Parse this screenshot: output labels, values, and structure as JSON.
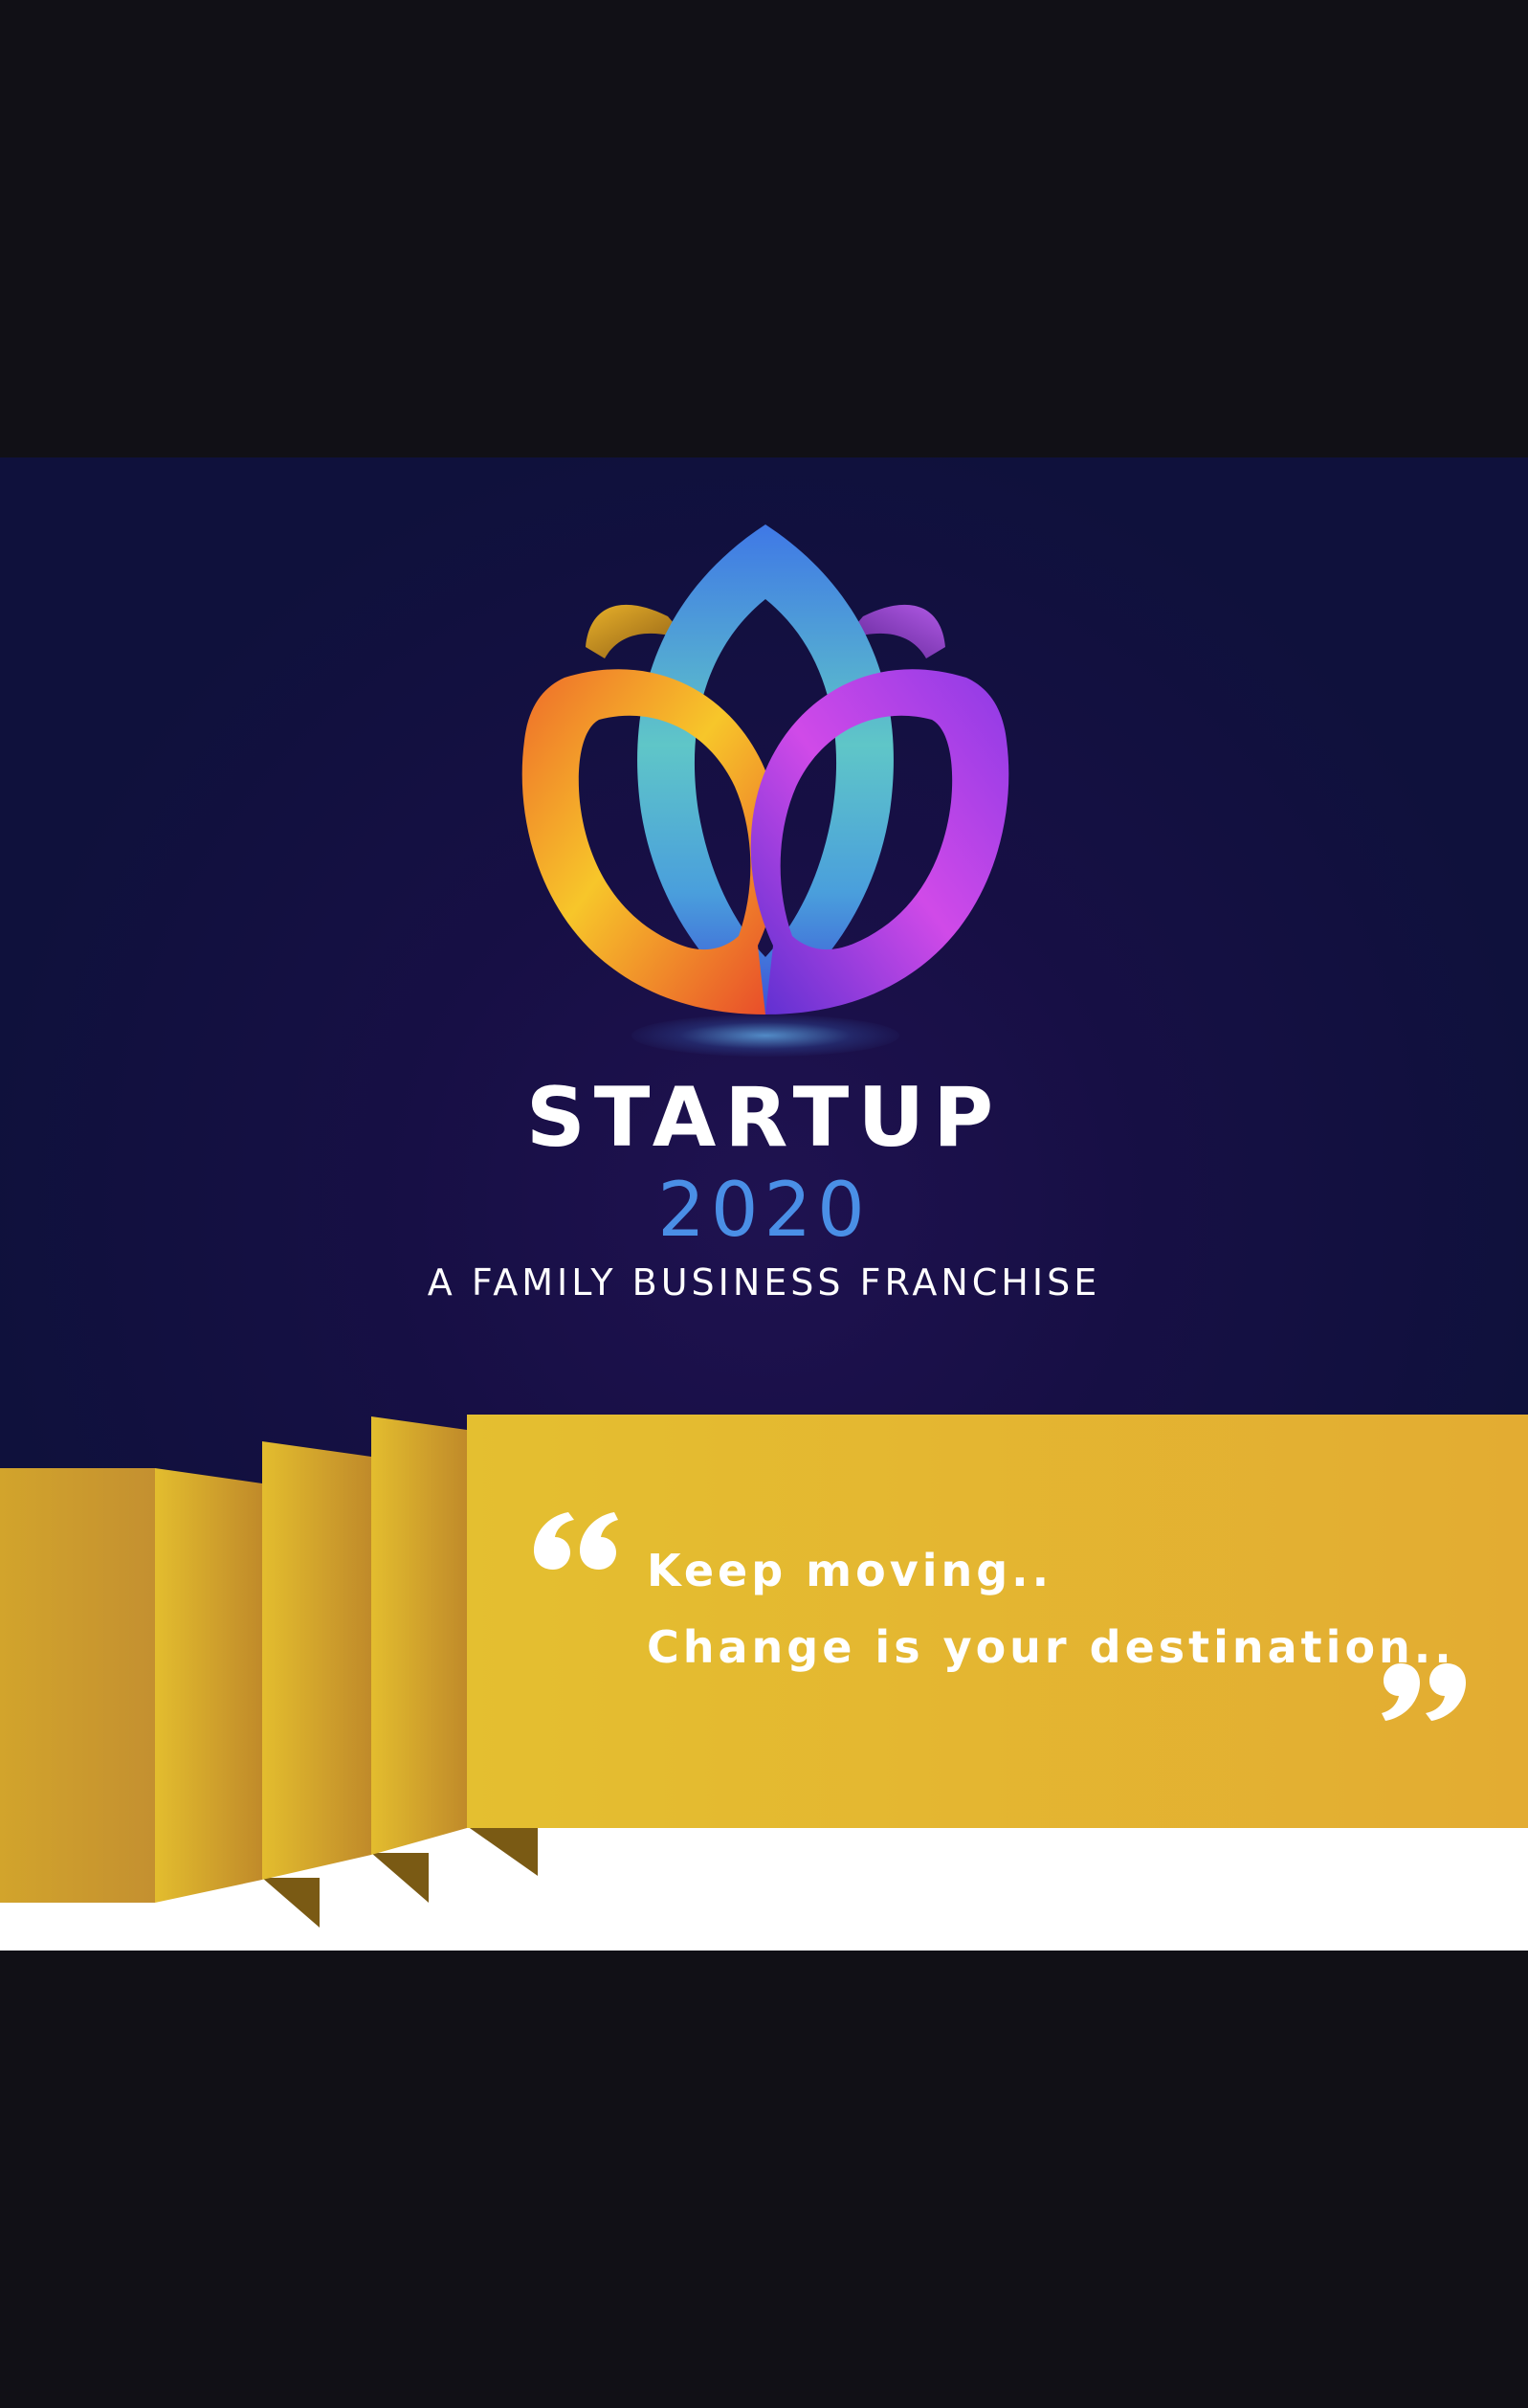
{
  "poster": {
    "title": "STARTUP",
    "year": "2020",
    "tagline": "A FAMILY BUSINESS FRANCHISE",
    "quote": {
      "line1": "Keep moving..",
      "line2": "Change is your destination.."
    }
  },
  "icons": {
    "logo": "lotus-logo-icon",
    "quote_open": "open-quote-icon",
    "quote_close": "close-quote-icon"
  },
  "colors": {
    "background_frame": "#111016",
    "poster_background": "#170f45",
    "year_accent": "#4a8fe6",
    "ribbon_gold": "#e2b62f",
    "text": "#ffffff"
  }
}
